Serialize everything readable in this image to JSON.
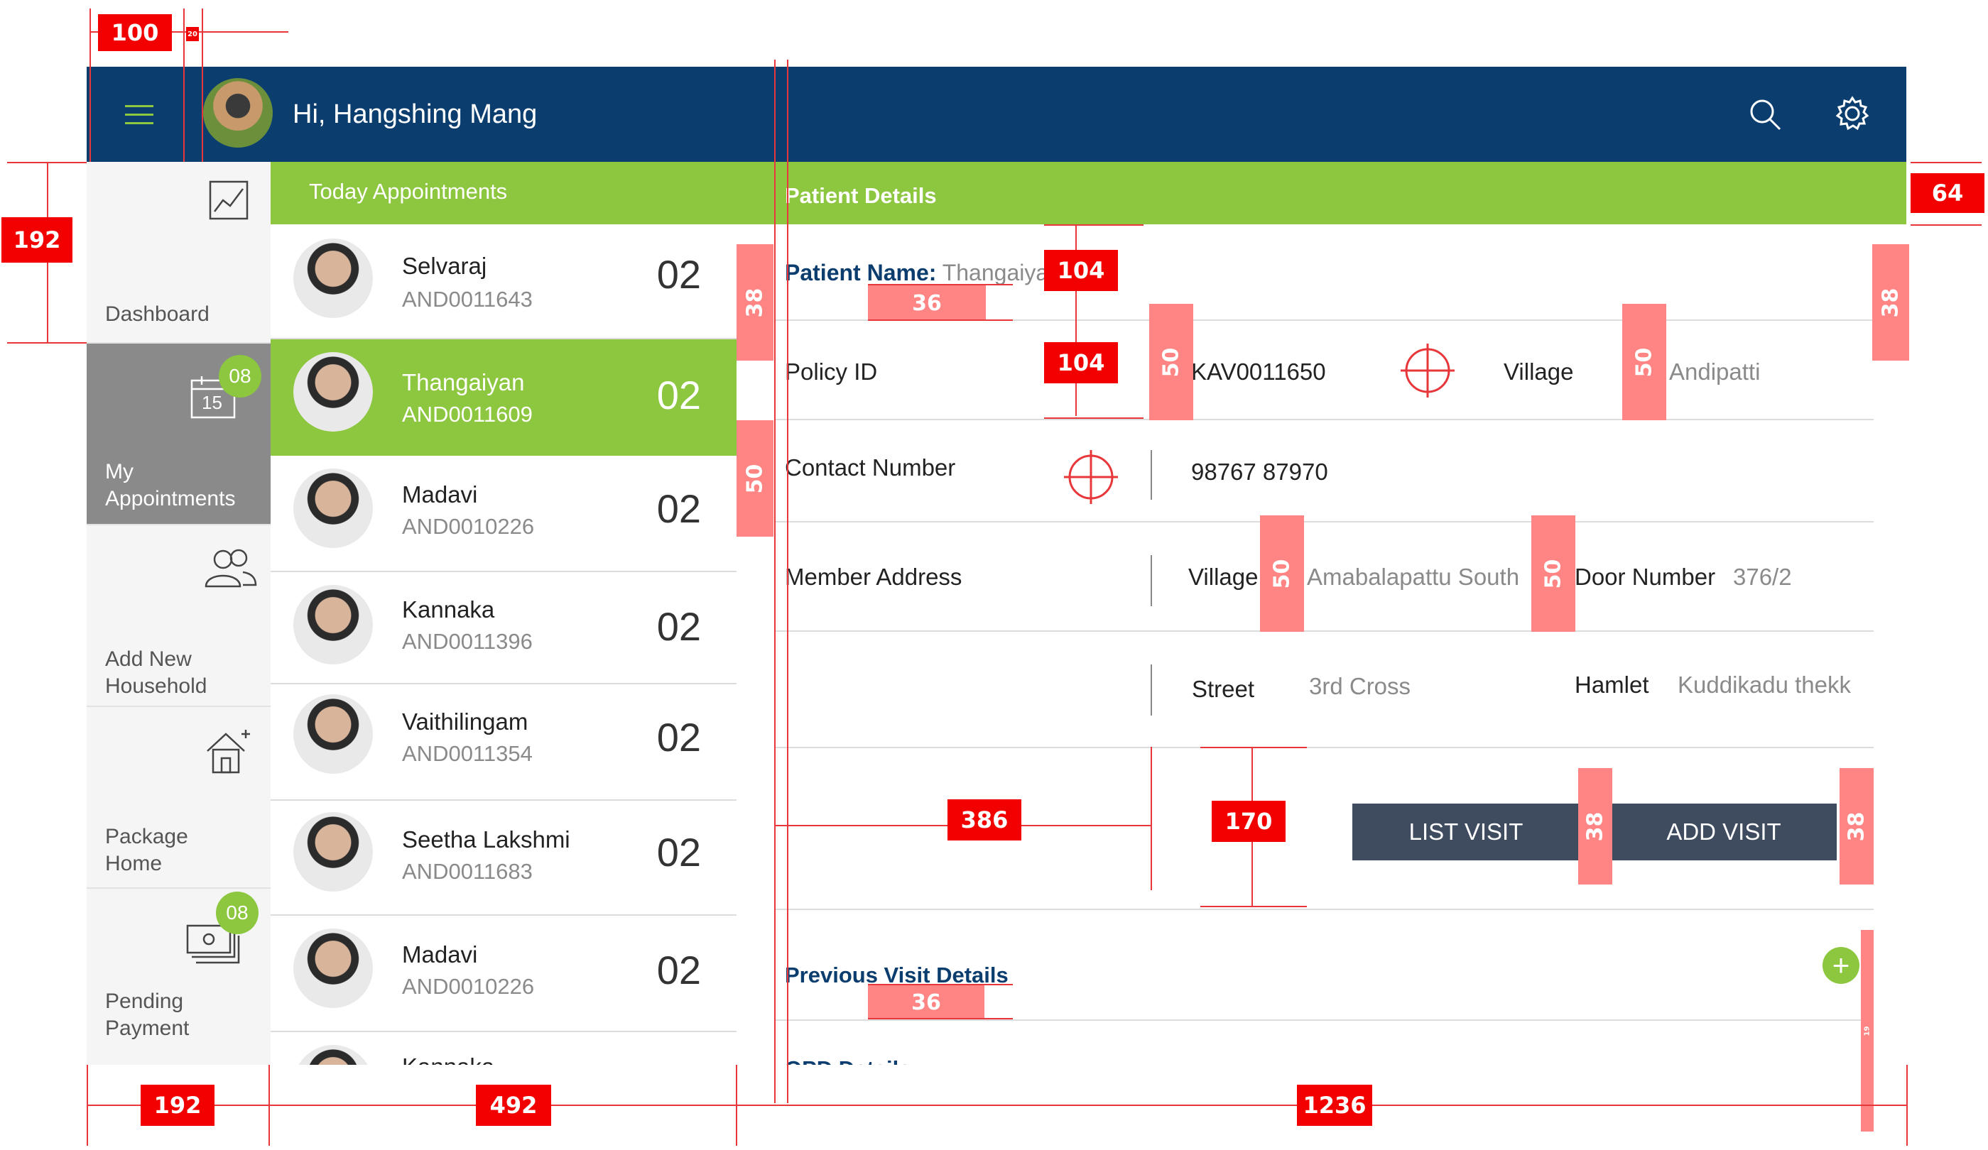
{
  "header": {
    "greeting": "Hi, Hangshing Mang"
  },
  "sidebar": {
    "items": [
      {
        "label": "Dashboard"
      },
      {
        "label": "My Appointments",
        "badge": "08",
        "calendar_day": "15"
      },
      {
        "label": "Add New Household"
      },
      {
        "label": "Package Home"
      },
      {
        "label": "Pending Payment",
        "badge": "08"
      }
    ]
  },
  "appointments": {
    "title": "Today Appointments",
    "rows": [
      {
        "name": "Selvaraj",
        "id": "AND0011643",
        "count": "02"
      },
      {
        "name": "Thangaiyan",
        "id": "AND0011609",
        "count": "02"
      },
      {
        "name": "Madavi",
        "id": "AND0010226",
        "count": "02"
      },
      {
        "name": "Kannaka",
        "id": "AND0011396",
        "count": "02"
      },
      {
        "name": "Vaithilingam",
        "id": "AND0011354",
        "count": "02"
      },
      {
        "name": "Seetha Lakshmi",
        "id": "AND0011683",
        "count": "02"
      },
      {
        "name": "Madavi",
        "id": "AND0010226",
        "count": "02"
      },
      {
        "name": "Kannaka",
        "id": "",
        "count": ""
      }
    ]
  },
  "patient": {
    "title": "Patient Details",
    "name_label": "Patient Name:",
    "name_value": "Thangaiya",
    "policy_label": "Policy ID",
    "policy_value": "KAV0011650",
    "village_label": "Village",
    "village_value": "Andipatti",
    "contact_label": "Contact Number",
    "contact_value": "98767 87970",
    "address_label": "Member Address",
    "addr_village_label": "Village",
    "addr_village_value": "Amabalapattu South",
    "door_label": "Door Number",
    "door_value": "376/2",
    "street_label": "Street",
    "street_value": "3rd Cross",
    "hamlet_label": "Hamlet",
    "hamlet_value": "Kuddikadu thekk",
    "list_visit": "LIST VISIT",
    "add_visit": "ADD VISIT",
    "previous_visit": "Previous Visit Details",
    "opd_partial": "OPD Details"
  },
  "annotations": {
    "w100": "100",
    "w20": "20",
    "h192": "192",
    "h64": "64",
    "s38": "38",
    "s36": "36",
    "s104": "104",
    "s50": "50",
    "s386": "386",
    "s170": "170",
    "s19": "19",
    "w192": "192",
    "w492": "492",
    "w1236": "1236"
  },
  "colors": {
    "header_blue": "#0b3e6f",
    "accent_green": "#8dc63f",
    "button_dark": "#3f4b5e",
    "annotation_red": "#f20000",
    "annotation_pink": "#ff8585"
  }
}
